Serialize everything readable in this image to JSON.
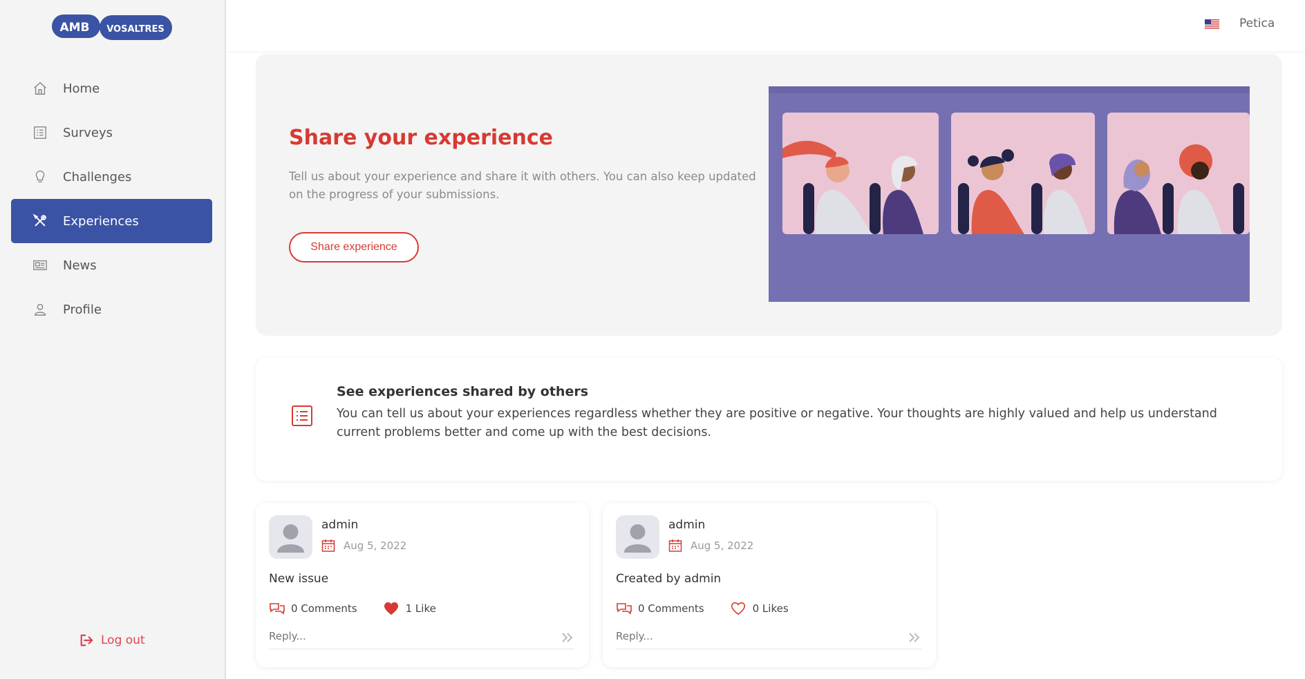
{
  "logo": {
    "left_text": "AMB",
    "right_text": "VOSALTRES",
    "color": "#3a53a4"
  },
  "sidebar": {
    "items": [
      {
        "label": "Home",
        "icon": "home-icon",
        "active": false
      },
      {
        "label": "Surveys",
        "icon": "list-icon",
        "active": false
      },
      {
        "label": "Challenges",
        "icon": "lightbulb-icon",
        "active": false
      },
      {
        "label": "Experiences",
        "icon": "tools-icon",
        "active": true
      },
      {
        "label": "News",
        "icon": "newspaper-icon",
        "active": false
      },
      {
        "label": "Profile",
        "icon": "user-icon",
        "active": false
      }
    ],
    "logout_label": "Log out"
  },
  "header": {
    "username": "Petica",
    "flag_icon": "us-flag-icon"
  },
  "hero": {
    "title": "Share your experience",
    "text": "Tell us about your experience and share it with others. You can also keep updated on the progress of your submissions.",
    "button_label": "Share experience"
  },
  "info": {
    "title": "See experiences shared by others",
    "text": "You can tell us about your experiences regardless whether they are positive or negative. Your thoughts are highly valued and help us understand current problems better and come up with the best decisions."
  },
  "cards": [
    {
      "author": "admin",
      "date": "Aug 5, 2022",
      "body": "New issue",
      "comments": "0 Comments",
      "likes": "1 Like",
      "liked": true,
      "reply_placeholder": "Reply..."
    },
    {
      "author": "admin",
      "date": "Aug 5, 2022",
      "body": "Created by admin",
      "comments": "0 Comments",
      "likes": "0 Likes",
      "liked": false,
      "reply_placeholder": "Reply..."
    }
  ],
  "colors": {
    "accent": "#d63a33",
    "nav_active": "#3a53a4",
    "logout": "#e0414f",
    "illustration_bg": "#7570b2"
  }
}
